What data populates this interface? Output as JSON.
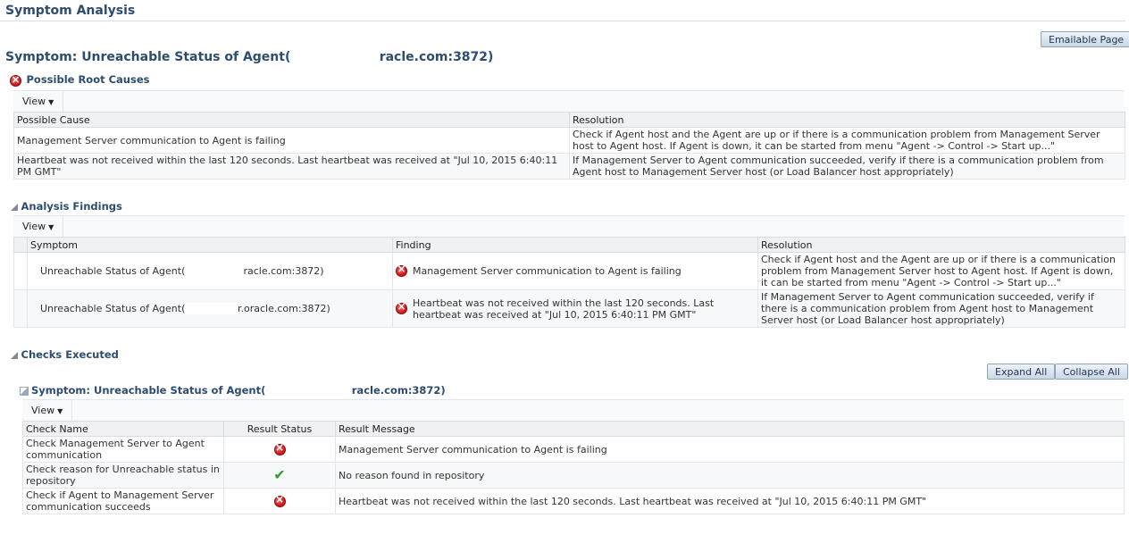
{
  "page": {
    "title": "Symptom Analysis",
    "emailable_label": "Emailable Page",
    "symptom_heading_prefix": "Symptom: Unreachable Status of Agent(",
    "symptom_heading_suffix": "racle.com:3872)"
  },
  "root_causes": {
    "heading": "Possible Root Causes",
    "view_label": "View",
    "columns": [
      "Possible Cause",
      "Resolution"
    ],
    "rows": [
      {
        "cause": "Management Server communication to Agent is failing",
        "resolution": "Check if Agent host and the Agent are up or if there is a communication problem from Management Server host to Agent host. If Agent is down, it can be started from menu \"Agent -> Control -> Start up...\""
      },
      {
        "cause": "Heartbeat was not received within the last 120 seconds. Last heartbeat was received at \"Jul 10, 2015 6:40:11 PM GMT\"",
        "resolution": "If Management Server to Agent communication succeeded, verify if there is a communication problem from Agent host to Management Server host (or Load Balancer host appropriately)"
      }
    ]
  },
  "findings": {
    "heading": "Analysis Findings",
    "view_label": "View",
    "columns": [
      "Symptom",
      "Finding",
      "Resolution"
    ],
    "rows": [
      {
        "symptom_prefix": "Unreachable Status of Agent(",
        "symptom_suffix": "racle.com:3872)",
        "finding": "Management Server communication to Agent is failing",
        "resolution": "Check if Agent host and the Agent are up or if there is a communication problem from Management Server host to Agent host. If Agent is down, it can be started from menu \"Agent -> Control -> Start up...\""
      },
      {
        "symptom_prefix": "Unreachable Status of Agent(",
        "symptom_suffix": "r.oracle.com:3872)",
        "finding": "Heartbeat was not received within the last 120 seconds. Last heartbeat was received at \"Jul 10, 2015 6:40:11 PM GMT\"",
        "resolution": "If Management Server to Agent communication succeeded, verify if there is a communication problem from Agent host to Management Server host (or Load Balancer host appropriately)"
      }
    ]
  },
  "checks": {
    "heading": "Checks Executed",
    "expand_all_label": "Expand All",
    "collapse_all_label": "Collapse All",
    "symptom_prefix": "Symptom: Unreachable Status of Agent(",
    "symptom_suffix": "racle.com:3872)",
    "view_label": "View",
    "columns": [
      "Check Name",
      "Result Status",
      "Result Message"
    ],
    "rows": [
      {
        "name": "Check Management Server to Agent communication",
        "status": "error-icon",
        "message": "Management Server communication to Agent is failing"
      },
      {
        "name": "Check reason for Unreachable status in repository",
        "status": "success-check-icon",
        "message": "No reason found in repository"
      },
      {
        "name": "Check if Agent to Management Server communication succeeds",
        "status": "error-icon",
        "message": "Heartbeat was not received within the last 120 seconds. Last heartbeat was received at \"Jul 10, 2015 6:40:11 PM GMT\""
      }
    ]
  },
  "colors": {
    "heading": "#2d4c6f",
    "error": "#d52020",
    "success": "#2e9d2e"
  }
}
